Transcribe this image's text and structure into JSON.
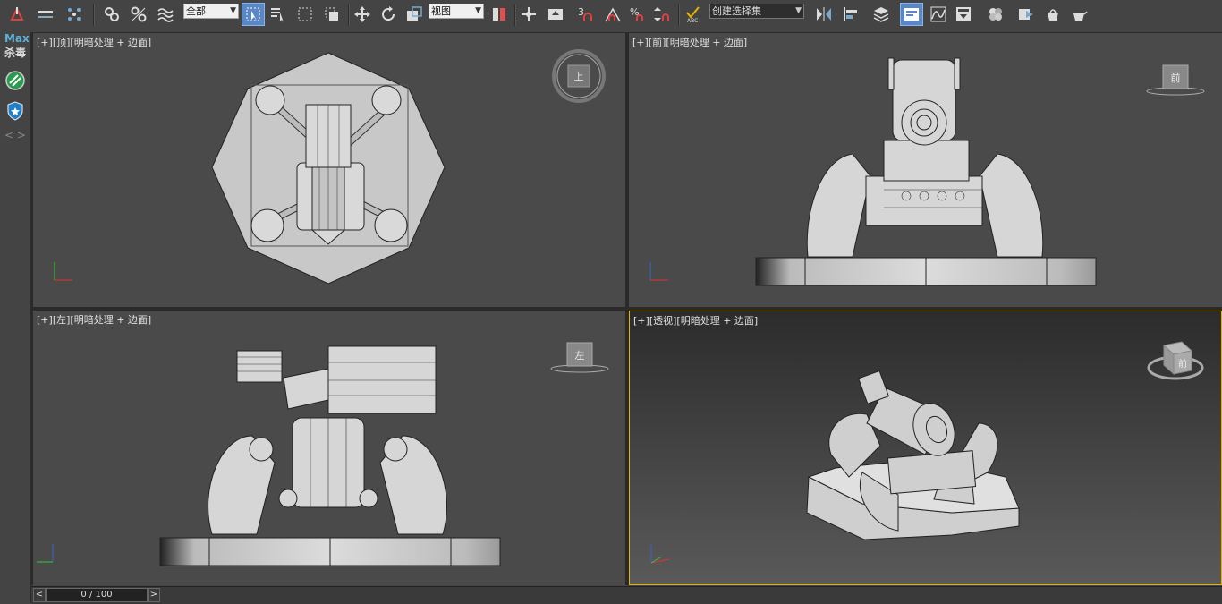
{
  "toolbar": {
    "selection_filter": "全部",
    "reference_coord": "视图",
    "named_selection_placeholder": "创建选择集",
    "snap_label": "3",
    "percent_snap_label": "%"
  },
  "leftbar": {
    "plugin_label_top": "Max",
    "plugin_label_bottom": "杀毒",
    "nav_arrows": "< >"
  },
  "viewports": {
    "top": {
      "plus": "[+]",
      "name": "[顶]",
      "mode": "[明暗处理 + 边面]",
      "cube_face": "上"
    },
    "front": {
      "plus": "[+]",
      "name": "[前]",
      "mode": "[明暗处理 + 边面]",
      "cube_face": "前"
    },
    "left": {
      "plus": "[+]",
      "name": "[左]",
      "mode": "[明暗处理 + 边面]",
      "cube_face": "左"
    },
    "persp": {
      "plus": "[+]",
      "name": "[透视]",
      "mode": "[明暗处理 + 边面]",
      "cube_face": "前"
    }
  },
  "axes": {
    "x": "x",
    "y": "y",
    "z": "z"
  },
  "timeline": {
    "frame": "0 / 100",
    "prev": "<",
    "next": ">"
  },
  "colors": {
    "active_border": "#e6b400",
    "viewport_bg": "#4a4a4a",
    "toolbar_active": "#5a88c6"
  }
}
